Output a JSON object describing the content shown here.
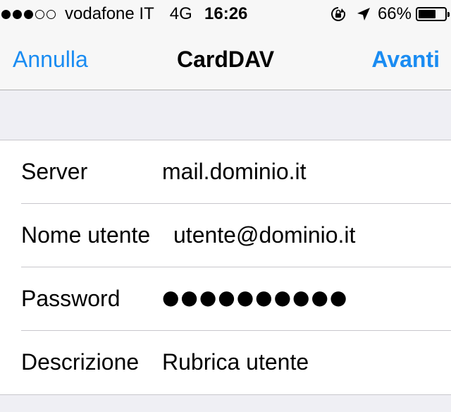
{
  "status_bar": {
    "carrier": "vodafone IT",
    "network": "4G",
    "time": "16:26",
    "battery_pct": "66%",
    "battery_level": 0.66,
    "signal_bars_filled": 3,
    "signal_bars_total": 5,
    "icons": [
      "orientation-lock-icon",
      "location-arrow-icon",
      "battery-icon"
    ]
  },
  "nav_bar": {
    "cancel_label": "Annulla",
    "title": "CardDAV",
    "next_label": "Avanti",
    "accent_color": "#1a8cf2"
  },
  "form": {
    "fields": [
      {
        "label": "Server",
        "value": "mail.dominio.it"
      },
      {
        "label": "Nome utente",
        "value": "utente@dominio.it"
      },
      {
        "label": "Password",
        "value": "●●●●●●●●●●"
      },
      {
        "label": "Descrizione",
        "value": "Rubrica utente"
      }
    ]
  }
}
